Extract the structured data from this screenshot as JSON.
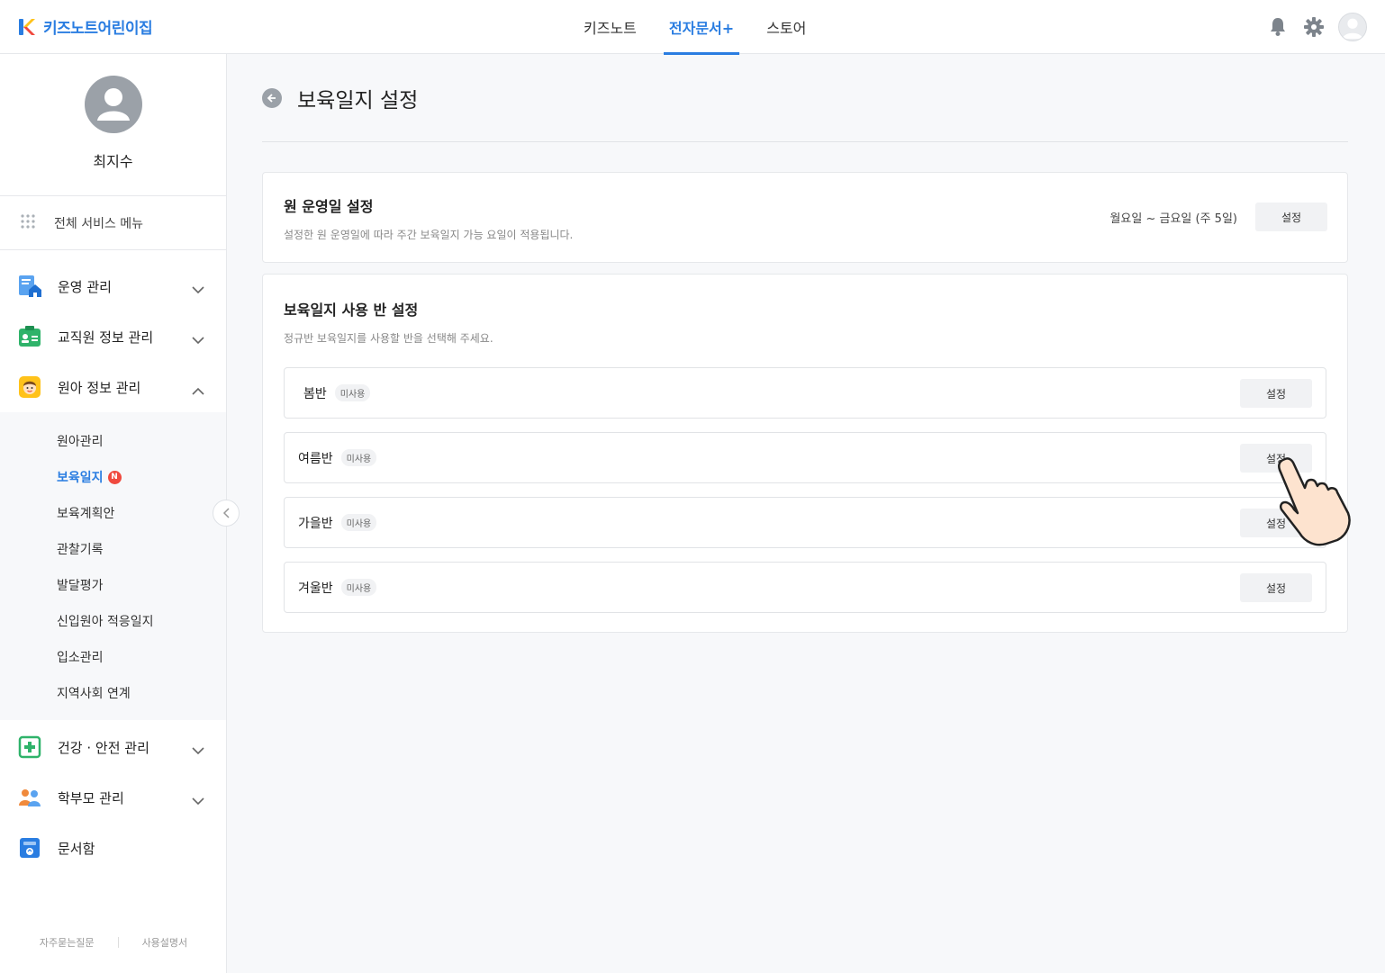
{
  "header": {
    "logo_text": "키즈노트어린이집",
    "nav": [
      {
        "label": "키즈노트",
        "active": false
      },
      {
        "label": "전자문서+",
        "active": true
      },
      {
        "label": "스토어",
        "active": false
      }
    ],
    "accent_color": "#2a7de1"
  },
  "sidebar": {
    "profile_name": "최지수",
    "all_menu_label": "전체 서비스 메뉴",
    "menu": [
      {
        "label": "운영 관리",
        "icon": "document-home-icon",
        "expanded": false
      },
      {
        "label": "교직원 정보 관리",
        "icon": "id-card-icon",
        "expanded": false
      },
      {
        "label": "원아 정보 관리",
        "icon": "child-face-icon",
        "expanded": true
      }
    ],
    "submenu": [
      {
        "label": "원아관리",
        "active": false
      },
      {
        "label": "보육일지",
        "active": true,
        "badge": "N"
      },
      {
        "label": "보육계획안",
        "active": false
      },
      {
        "label": "관찰기록",
        "active": false
      },
      {
        "label": "발달평가",
        "active": false
      },
      {
        "label": "신입원아 적응일지",
        "active": false
      },
      {
        "label": "입소관리",
        "active": false
      },
      {
        "label": "지역사회 연계",
        "active": false
      }
    ],
    "menu_bottom": [
      {
        "label": "건강 · 안전 관리",
        "icon": "health-cross-icon",
        "expanded": false
      },
      {
        "label": "학부모 관리",
        "icon": "parents-icon",
        "expanded": false
      },
      {
        "label": "문서함",
        "icon": "document-box-icon"
      }
    ],
    "footer": {
      "faq": "자주묻는질문",
      "manual": "사용설명서"
    }
  },
  "main": {
    "title": "보육일지 설정",
    "operating_days": {
      "title": "원 운영일 설정",
      "desc": "설정한 원 운영일에 따라 주간 보육일지 가능 요일이 적용됩니다.",
      "value": "월요일 ~ 금요일 (주 5일)",
      "button": "설정"
    },
    "class_setting": {
      "title": "보육일지 사용 반 설정",
      "desc": "정규반 보육일지를 사용할 반을 선택해 주세요.",
      "classes": [
        {
          "name": "봄반",
          "status": "미사용",
          "button": "설정"
        },
        {
          "name": "여름반",
          "status": "미사용",
          "button": "설정"
        },
        {
          "name": "가을반",
          "status": "미사용",
          "button": "설정"
        },
        {
          "name": "겨울반",
          "status": "미사용",
          "button": "설정"
        }
      ]
    }
  }
}
